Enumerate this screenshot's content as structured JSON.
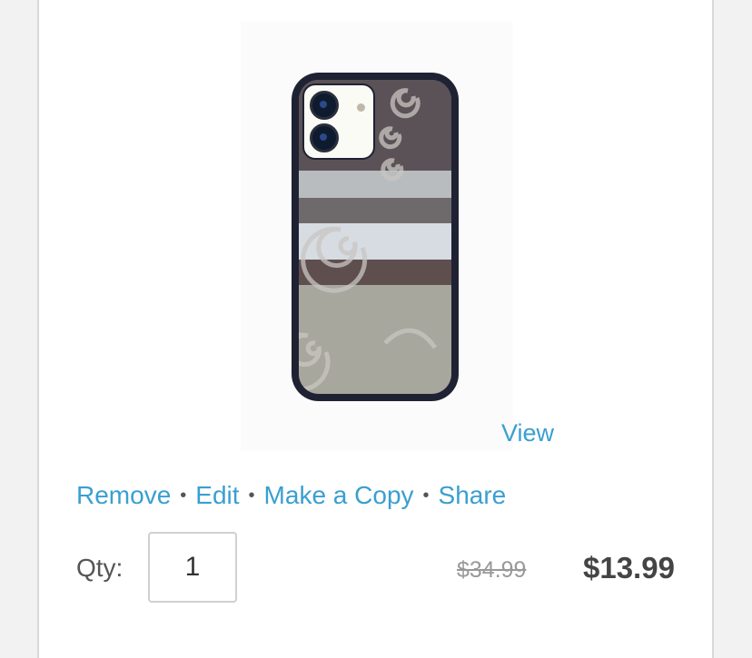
{
  "product": {
    "image_alt": "Phone case with swirl pattern",
    "view_label": "View"
  },
  "actions": {
    "remove_label": "Remove",
    "edit_label": "Edit",
    "copy_label": "Make a Copy",
    "share_label": "Share",
    "separator": "•"
  },
  "quantity": {
    "label": "Qty:",
    "value": "1"
  },
  "price": {
    "original": "$34.99",
    "sale": "$13.99"
  },
  "colors": {
    "link": "#3a9fd0",
    "price": "#444444",
    "phone_bumper": "#1f2233"
  }
}
